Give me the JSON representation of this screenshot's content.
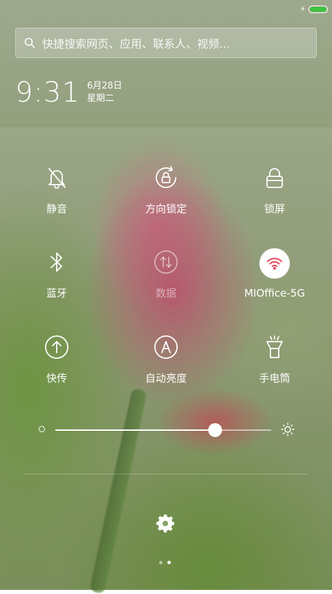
{
  "status_bar": {
    "battery_color": "#3ec43e",
    "battery_level": 1.0,
    "charging": true
  },
  "search": {
    "placeholder": "快捷搜索网页、应用、联系人、视频..."
  },
  "clock": {
    "time": "9:31",
    "date": "6月28日",
    "weekday": "星期二"
  },
  "toggles": [
    {
      "label": "静音",
      "icon": "bell-off-icon",
      "state": "off"
    },
    {
      "label": "方向锁定",
      "icon": "rotation-lock-icon",
      "state": "off"
    },
    {
      "label": "锁屏",
      "icon": "lock-icon",
      "state": "off"
    },
    {
      "label": "蓝牙",
      "icon": "bluetooth-icon",
      "state": "off"
    },
    {
      "label": "数据",
      "icon": "mobile-data-icon",
      "state": "disabled"
    },
    {
      "label": "MIOffice-5G",
      "icon": "wifi-icon",
      "state": "on"
    },
    {
      "label": "快传",
      "icon": "quick-transfer-icon",
      "state": "off"
    },
    {
      "label": "自动亮度",
      "icon": "auto-brightness-icon",
      "state": "off"
    },
    {
      "label": "手电筒",
      "icon": "flashlight-icon",
      "state": "off"
    }
  ],
  "brightness": {
    "level": 0.74
  },
  "pager": {
    "pages": 2,
    "current": 2
  },
  "colors": {
    "accent_active": "#ffffff",
    "wifi_icon": "#e25563"
  }
}
